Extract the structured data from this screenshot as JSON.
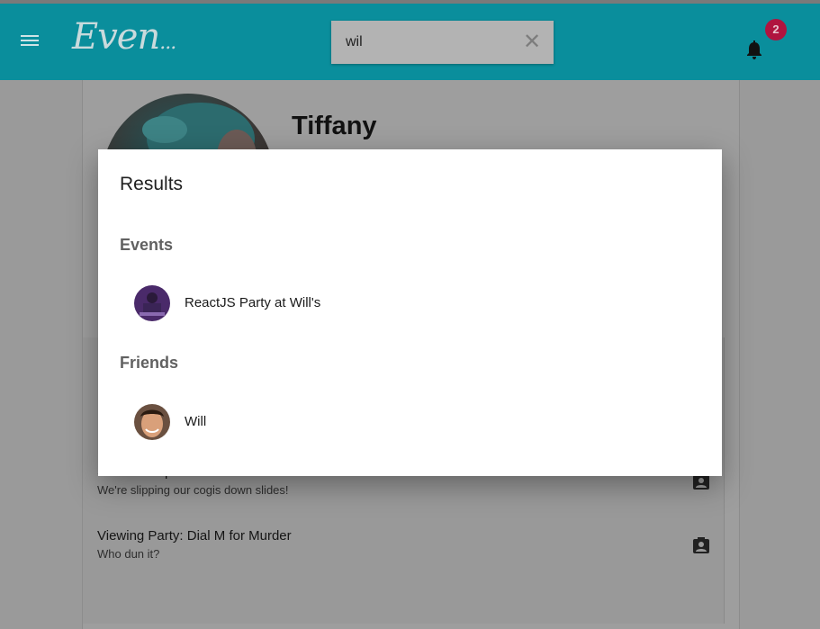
{
  "header": {
    "logo_text": "Even",
    "logo_dots": "...",
    "search_value": "wil",
    "clear_symbol": "✕",
    "notification_count": "2",
    "accent_color": "#0a8e9c",
    "badge_color": "#b0143f"
  },
  "profile": {
    "name": "Tiffany"
  },
  "events_list": [
    {
      "title": "Slide on Slip N Slide Lunch Series",
      "subtitle": "We're slipping our cogis down slides!"
    },
    {
      "title": "Viewing Party: Dial M for Murder",
      "subtitle": "Who dun it?"
    }
  ],
  "results_dialog": {
    "title": "Results",
    "events_heading": "Events",
    "events": [
      {
        "label": "ReactJS Party at Will's"
      }
    ],
    "friends_heading": "Friends",
    "friends": [
      {
        "label": "Will"
      }
    ]
  }
}
